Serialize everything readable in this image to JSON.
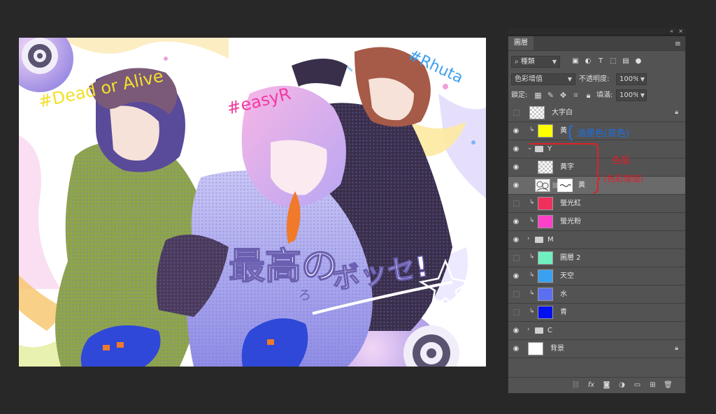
{
  "artwork": {
    "texts": {
      "hashtag_1": "#Dead or Alive",
      "hashtag_2": "#easyR",
      "hashtag_3": "#Rhuta",
      "title_line": "最高の",
      "title_sub": "ボッセ!",
      "title_ruby": "ろ"
    },
    "colors": {
      "bg": "#ffffff",
      "purple": "#8e7cd6",
      "pink": "#f2a0d8",
      "yellow": "#f7e23a",
      "blue": "#3a4fd6",
      "green": "#6d8d3a",
      "dark": "#2e2640"
    }
  },
  "panel": {
    "tab_label": "圖層",
    "menu_icon": "hamburger-icon",
    "collapse_glyph": "«",
    "close_glyph": "×",
    "filter": {
      "kind_value": "種類",
      "icons": [
        "image-icon",
        "adjustment-icon",
        "type-icon",
        "shape-icon",
        "smartobject-icon",
        "filter-toggle-icon"
      ]
    },
    "blend_mode": "色彩增值",
    "opacity_label": "不透明度:",
    "opacity_value": "100%",
    "lock_label": "鎖定:",
    "fill_label": "填滿:",
    "fill_value": "100%",
    "layers": [
      {
        "name": "大字白",
        "visible": false,
        "type": "layer",
        "thumb": "checker",
        "locked": true,
        "clipped": false
      },
      {
        "name": "黃",
        "visible": true,
        "type": "layer",
        "thumb": "#ffff00",
        "clipped": true
      },
      {
        "name": "Y",
        "visible": true,
        "type": "group",
        "expanded": true
      },
      {
        "name": "黃字",
        "visible": true,
        "type": "layer",
        "thumb": "checker",
        "indent": true
      },
      {
        "name": "黃",
        "visible": true,
        "type": "layer",
        "thumb": "art",
        "mask": true,
        "indent": true,
        "selected": true
      },
      {
        "name": "螢光紅",
        "visible": false,
        "type": "layer",
        "thumb": "#f0305c",
        "clipped": true
      },
      {
        "name": "螢光粉",
        "visible": true,
        "type": "layer",
        "thumb": "#ff40c8",
        "clipped": true
      },
      {
        "name": "M",
        "visible": true,
        "type": "group",
        "expanded": false
      },
      {
        "name": "圖層 2",
        "visible": false,
        "type": "layer",
        "thumb": "#70f0c0",
        "clipped": true
      },
      {
        "name": "天空",
        "visible": true,
        "type": "layer",
        "thumb": "#3aa0f0",
        "clipped": true
      },
      {
        "name": "水",
        "visible": false,
        "type": "layer",
        "thumb": "#5a70f0",
        "clipped": true
      },
      {
        "name": "青",
        "visible": false,
        "type": "layer",
        "thumb": "#0010f0",
        "clipped": true
      },
      {
        "name": "C",
        "visible": true,
        "type": "group",
        "expanded": false
      },
      {
        "name": "背景",
        "visible": true,
        "type": "layer",
        "thumb": "#ffffff",
        "locked": true
      }
    ],
    "annotations": {
      "blue_note": "油墨色(底色)",
      "red_note_1": "色版",
      "red_note_2": "(色彩增值)",
      "blue_color": "#1f6fe0",
      "red_color": "#e0202a"
    },
    "bottom_icons": [
      "link-icon",
      "fx-icon",
      "mask-icon",
      "adjustment-layer-icon",
      "folder-icon",
      "new-layer-icon",
      "trash-icon"
    ]
  }
}
